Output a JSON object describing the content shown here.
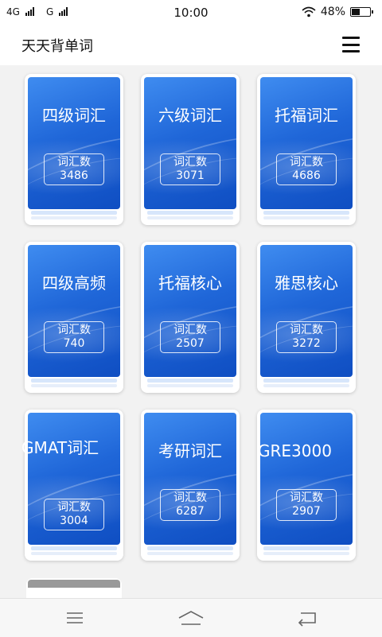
{
  "status": {
    "network1": "4G",
    "network2": "G",
    "time": "10:00",
    "battery": "48%",
    "battery_level": 0.48
  },
  "header": {
    "title": "天天背单词"
  },
  "count_label": "词汇数",
  "books": [
    {
      "title": "四级词汇",
      "count": "3486"
    },
    {
      "title": "六级词汇",
      "count": "3071"
    },
    {
      "title": "托福词汇",
      "count": "4686"
    },
    {
      "title": "四级高频",
      "count": "740"
    },
    {
      "title": "托福核心",
      "count": "2507"
    },
    {
      "title": "雅思核心",
      "count": "3272"
    },
    {
      "title": "GMAT词汇",
      "count": "3004"
    },
    {
      "title": "考研词汇",
      "count": "6287"
    },
    {
      "title": "GRE3000",
      "count": "2907"
    }
  ],
  "icons": {
    "menu": "hamburger-icon",
    "nav_menu": "menu-lines-icon",
    "nav_home": "home-icon",
    "nav_back": "back-icon"
  }
}
